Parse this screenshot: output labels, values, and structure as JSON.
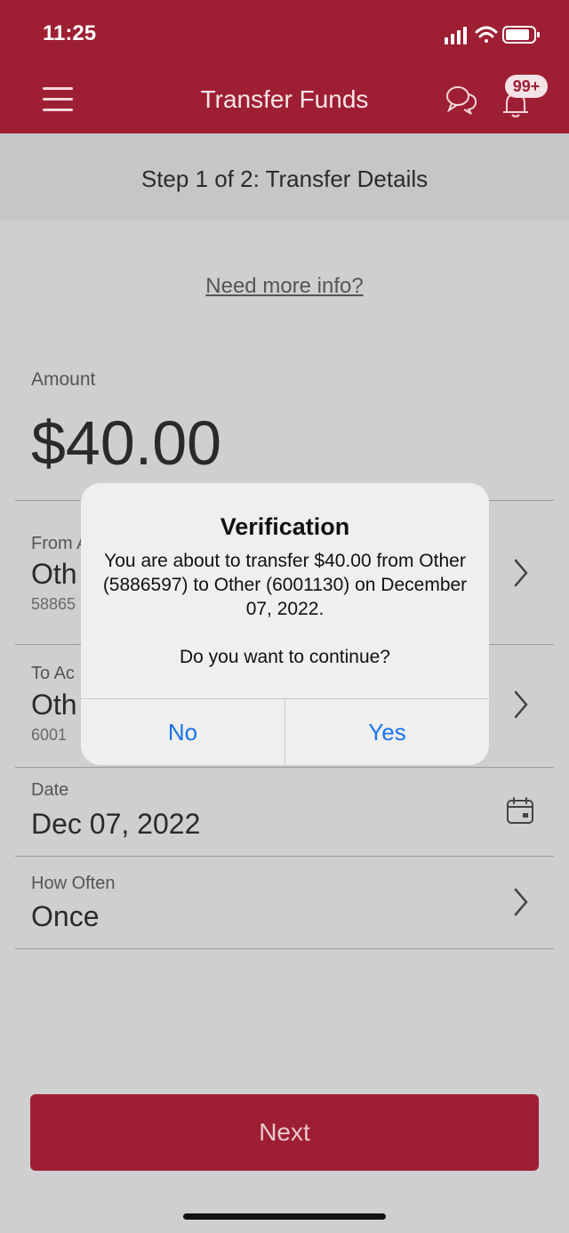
{
  "status": {
    "time": "11:25"
  },
  "header": {
    "title": "Transfer Funds",
    "badge": "99+"
  },
  "step": {
    "text": "Step 1 of 2: Transfer Details"
  },
  "info_link": "Need more info?",
  "amount": {
    "label": "Amount",
    "value": "$40.00"
  },
  "from": {
    "label": "From A",
    "value": "Oth",
    "account": "58865"
  },
  "to": {
    "label": "To Ac",
    "value": "Oth",
    "account": "6001"
  },
  "date": {
    "label": "Date",
    "value": "Dec 07, 2022"
  },
  "how_often": {
    "label": "How Often",
    "value": "Once"
  },
  "next_label": "Next",
  "dialog": {
    "title": "Verification",
    "message": "You are about to transfer $40.00 from Other (5886597) to Other (6001130) on December 07, 2022.",
    "question": "Do you want to continue?",
    "no_label": "No",
    "yes_label": "Yes"
  },
  "colors": {
    "brand": "#9e1f33",
    "link_blue": "#1a73e8"
  }
}
